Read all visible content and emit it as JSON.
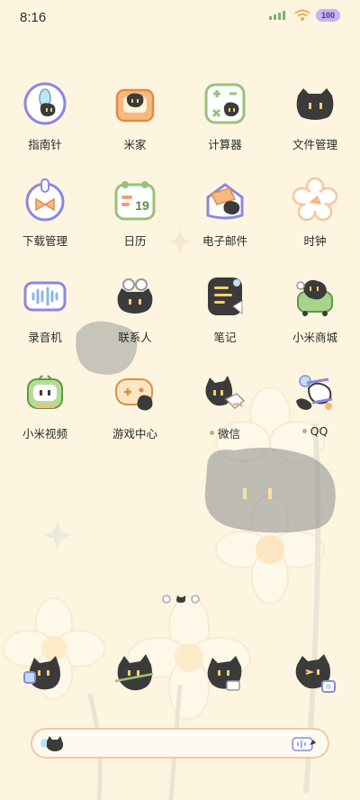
{
  "status_bar": {
    "time": "8:16",
    "signal_text": "ᵘ",
    "battery": "100"
  },
  "apps": [
    {
      "label": "指南针",
      "icon": "compass-icon",
      "dot": false
    },
    {
      "label": "米家",
      "icon": "home-icon",
      "dot": false
    },
    {
      "label": "计算器",
      "icon": "calculator-icon",
      "dot": false
    },
    {
      "label": "文件管理",
      "icon": "folder-icon",
      "dot": false
    },
    {
      "label": "下载管理",
      "icon": "download-icon",
      "dot": false
    },
    {
      "label": "日历",
      "icon": "calendar-icon",
      "dot": false,
      "day": "19"
    },
    {
      "label": "电子邮件",
      "icon": "mail-icon",
      "dot": false
    },
    {
      "label": "时钟",
      "icon": "clock-icon",
      "dot": false
    },
    {
      "label": "录音机",
      "icon": "recorder-icon",
      "dot": false
    },
    {
      "label": "联系人",
      "icon": "contacts-icon",
      "dot": false
    },
    {
      "label": "笔记",
      "icon": "notes-icon",
      "dot": false
    },
    {
      "label": "小米商城",
      "icon": "store-icon",
      "dot": false
    },
    {
      "label": "小米视频",
      "icon": "video-icon",
      "dot": false
    },
    {
      "label": "游戏中心",
      "icon": "game-icon",
      "dot": false
    },
    {
      "label": "微信",
      "icon": "wechat-icon",
      "dot": true
    },
    {
      "label": "QQ",
      "icon": "qq-icon",
      "dot": true
    }
  ],
  "dock": [
    {
      "icon": "phone-icon"
    },
    {
      "icon": "messages-icon"
    },
    {
      "icon": "browser-icon"
    },
    {
      "icon": "camera-icon"
    }
  ],
  "search": {
    "placeholder": ""
  },
  "colors": {
    "background": "#fdf5df",
    "cat": "#3b3b3b",
    "accent_orange": "#f2a95c",
    "accent_purple": "#9b8fe6",
    "accent_green": "#9ac27a"
  }
}
